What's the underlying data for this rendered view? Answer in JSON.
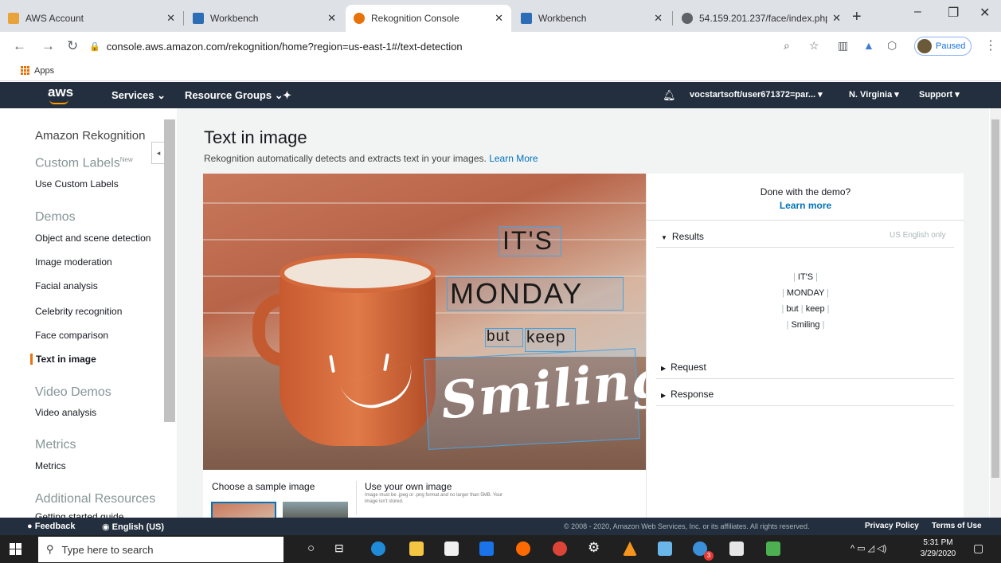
{
  "browser": {
    "tabs": [
      {
        "label": "AWS Account",
        "favicon_color": "#e8a33a"
      },
      {
        "label": "Workbench",
        "favicon_color": "#2d6db5"
      },
      {
        "label": "Rekognition Console",
        "favicon_color": "#e8710a",
        "active": true
      },
      {
        "label": "Workbench",
        "favicon_color": "#2d6db5"
      },
      {
        "label": "54.159.201.237/face/index.php",
        "favicon_color": "#5f6368"
      }
    ],
    "url": "console.aws.amazon.com/rekognition/home?region=us-east-1#/text-detection",
    "profile_status": "Paused",
    "bookmarks_apps": "Apps"
  },
  "aws_nav": {
    "logo": "aws",
    "services": "Services",
    "resource_groups": "Resource Groups",
    "account": "vocstartsoft/user671372=par...",
    "region": "N. Virginia",
    "support": "Support"
  },
  "sidebar": {
    "title": "Amazon Rekognition",
    "custom_labels_head": "Custom Labels",
    "new_badge": "New",
    "use_custom_labels": "Use Custom Labels",
    "demos_head": "Demos",
    "demos": [
      "Object and scene detection",
      "Image moderation",
      "Facial analysis",
      "Celebrity recognition",
      "Face comparison",
      "Text in image"
    ],
    "video_head": "Video Demos",
    "video_analysis": "Video analysis",
    "metrics_head": "Metrics",
    "metrics": "Metrics",
    "additional_head": "Additional Resources",
    "getting_started": "Getting started guide"
  },
  "main": {
    "title": "Text in image",
    "description": "Rekognition automatically detects and extracts text in your images.",
    "learn_more": "Learn More",
    "image_text": {
      "its": "IT'S",
      "monday": "MONDAY",
      "but": "but",
      "keep": "keep",
      "smiling": "Smiling"
    },
    "choose_sample": "Choose a sample image",
    "use_own": "Use your own image",
    "use_own_note": "Image must be .jpeg or .png format and no larger than 5MB. Your image isn't stored."
  },
  "results_panel": {
    "done_demo": "Done with the demo?",
    "learn_more": "Learn more",
    "results_label": "Results",
    "language_note": "US English only",
    "lines": [
      [
        "IT'S"
      ],
      [
        "MONDAY"
      ],
      [
        "but",
        "keep"
      ],
      [
        "Smiling"
      ]
    ],
    "request_label": "Request",
    "response_label": "Response"
  },
  "footer": {
    "feedback": "Feedback",
    "language": "English (US)",
    "copyright": "© 2008 - 2020, Amazon Web Services, Inc. or its affiliates. All rights reserved.",
    "privacy": "Privacy Policy",
    "terms": "Terms of Use"
  },
  "taskbar": {
    "search_placeholder": "Type here to search",
    "time": "5:31 PM",
    "date": "3/29/2020",
    "badge_count": "3"
  }
}
